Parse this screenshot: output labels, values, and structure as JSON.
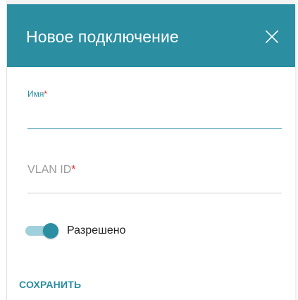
{
  "dialog": {
    "title": "Новое подключение",
    "close_icon": "close-icon"
  },
  "form": {
    "name_field": {
      "label": "Имя",
      "required_mark": "*",
      "value": "",
      "placeholder": ""
    },
    "vlan_field": {
      "label": "VLAN ID",
      "required_mark": "*",
      "value": ""
    },
    "enabled_toggle": {
      "label": "Разрешено",
      "state": "on"
    }
  },
  "actions": {
    "save_label": "СОХРАНИТЬ"
  },
  "colors": {
    "accent": "#2b8ea1",
    "required": "#e0262b",
    "toggle_track": "#9fd0db"
  }
}
